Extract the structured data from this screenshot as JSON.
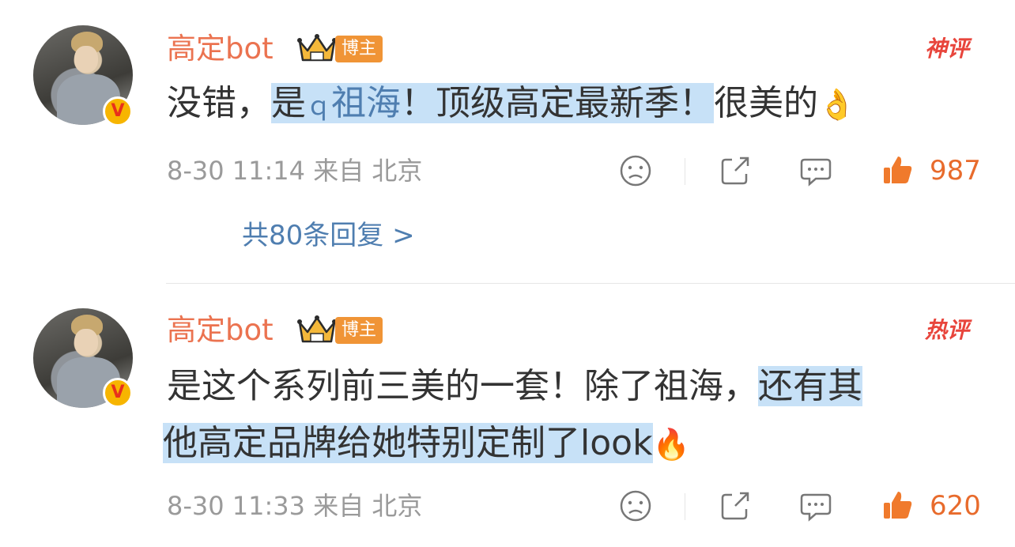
{
  "comments": [
    {
      "username": "高定bot",
      "blogger_badge": "博主",
      "tag": "神评",
      "text_prefix": "没错，",
      "text_hl_1": "是",
      "search_glyph": "ｑ",
      "text_link": "祖海",
      "text_hl_2": "！顶级高定最新季！",
      "text_suffix": "很美的",
      "emoji": "👌",
      "date": "8-30 11:14",
      "location": "来自 北京",
      "likes": "987",
      "replies": "共80条回复 >"
    },
    {
      "username": "高定bot",
      "blogger_badge": "博主",
      "tag": "热评",
      "text_line1_plain": "是这个系列前三美的一套！除了祖海，",
      "text_line1_hl": "还有其",
      "text_line2_hl": "他高定品牌给她特别定制了look",
      "emoji": "🔥",
      "date": "8-30 11:33",
      "location": "来自 北京",
      "likes": "620"
    }
  ],
  "icons": [
    "sad-face-icon",
    "share-icon",
    "comment-icon",
    "like-icon",
    "crown-icon",
    "verified-v-icon"
  ],
  "colors": {
    "username": "#eb7350",
    "highlight": "#c7e1f7",
    "link": "#4f7eb0",
    "meta": "#9a9a9a",
    "like": "#e86b2c",
    "tag": "#e8453c",
    "badge": "#f09436"
  }
}
